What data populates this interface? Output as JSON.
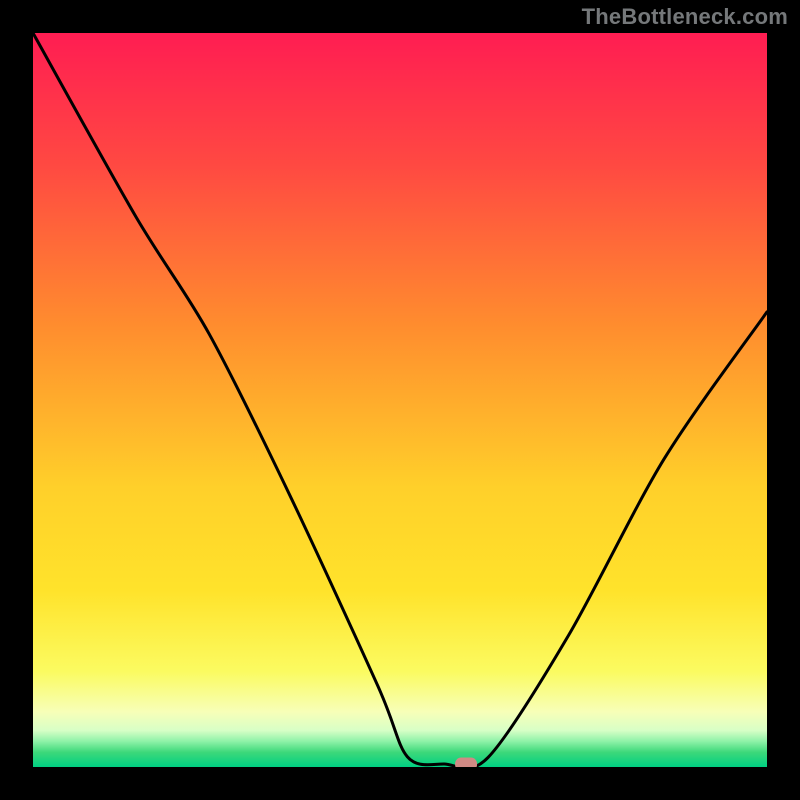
{
  "attribution": "TheBottleneck.com",
  "chart_data": {
    "type": "line",
    "title": "",
    "xlabel": "",
    "ylabel": "",
    "xlim": [
      0,
      100
    ],
    "ylim": [
      0,
      100
    ],
    "background_gradient": {
      "top": "#ff1d52",
      "upper_mid": "#ff8d2e",
      "mid": "#ffe32b",
      "lower_mid": "#f7fb7a",
      "band_light": "#e6ffbf",
      "band_green": "#3dd87a",
      "base": "#00d082"
    },
    "curve_points": [
      {
        "x": 0,
        "y": 100
      },
      {
        "x": 14,
        "y": 75
      },
      {
        "x": 24,
        "y": 59
      },
      {
        "x": 35,
        "y": 37
      },
      {
        "x": 47,
        "y": 11
      },
      {
        "x": 51,
        "y": 1.4
      },
      {
        "x": 56,
        "y": 0.4
      },
      {
        "x": 62,
        "y": 1.3
      },
      {
        "x": 73,
        "y": 18
      },
      {
        "x": 86,
        "y": 42
      },
      {
        "x": 100,
        "y": 62
      }
    ],
    "marker": {
      "x": 59,
      "y": 0.4,
      "color": "#d08a84"
    }
  }
}
